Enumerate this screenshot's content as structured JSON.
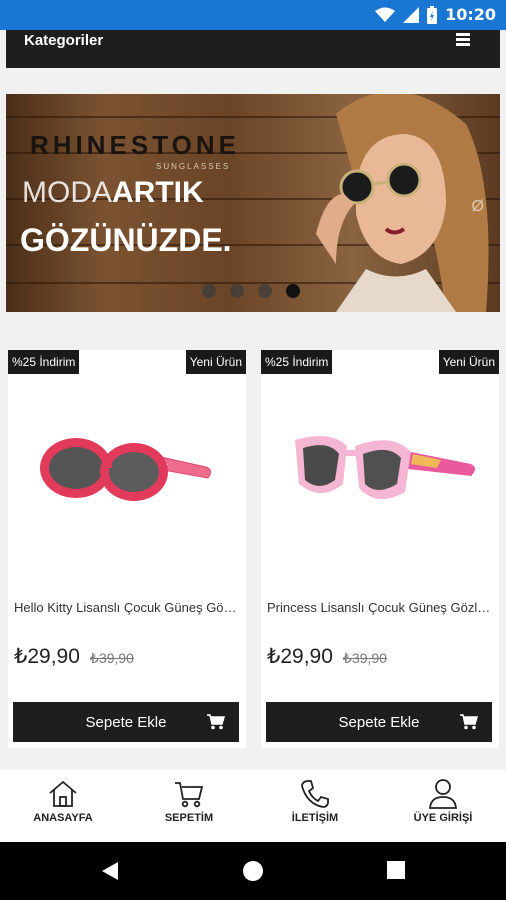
{
  "status_bar": {
    "time": "10:20",
    "icons": [
      "wifi-icon",
      "signal-icon",
      "battery-icon"
    ]
  },
  "category_bar": {
    "label": "Kategoriler",
    "menu_icon": "hamburger-menu-icon"
  },
  "banner": {
    "brand": "RHINESTONE",
    "brand_sub": "SUNGLASSES",
    "slogan_thin": "MODA",
    "slogan_bold": "ARTIK",
    "slogan_line2": "GÖZÜNÜZDE.",
    "slide_count": 4,
    "active_slide": 4
  },
  "products": [
    {
      "discount_badge": "%25 İndirim",
      "new_badge": "Yeni Ürün",
      "name": "Hello Kitty Lisanslı Çocuk Güneş Gözlüğü",
      "price": "₺29,90",
      "old_price": "₺39,90",
      "button_label": "Sepete Ekle",
      "frame_color": "#e23a5a",
      "temple_color": "#f06c8e"
    },
    {
      "discount_badge": "%25 İndirim",
      "new_badge": "Yeni Ürün",
      "name": "Princess Lisanslı Çocuk Güneş Gözlüğü",
      "price": "₺29,90",
      "old_price": "₺39,90",
      "button_label": "Sepete Ekle",
      "frame_color": "#f4b6d2",
      "temple_color": "#e85a9c"
    }
  ],
  "bottom_nav": [
    {
      "label": "ANASAYFA",
      "icon": "home-icon"
    },
    {
      "label": "SEPETİM",
      "icon": "cart-icon"
    },
    {
      "label": "İLETİŞİM",
      "icon": "phone-icon"
    },
    {
      "label": "ÜYE GİRİŞİ",
      "icon": "user-icon"
    }
  ],
  "colors": {
    "status_bar": "#1976d2",
    "dark": "#1e1e1e",
    "background": "#f1f1f1"
  }
}
